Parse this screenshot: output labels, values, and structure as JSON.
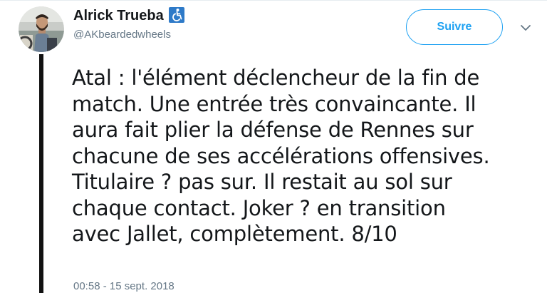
{
  "tweet": {
    "author": {
      "display_name": "Alrick Trueba",
      "badge_icon": "wheelchair-accessibility-icon",
      "handle": "@AKbeardedwheels",
      "avatar_icon": "profile-photo"
    },
    "follow_label": "Suivre",
    "menu_icon": "chevron-down-icon",
    "text": "Atal : l'élément déclencheur de la fin de\nmatch. Une entrée très convaincante. Il\naura fait plier la défense de Rennes sur\nchacune de ses accélérations offensives.\nTitulaire ? pas sur. Il restait au sol sur\nchaque contact. Joker ? en transition\navec Jallet, complètement. 8/10",
    "timestamp": "00:58 - 15 sept. 2018"
  },
  "colors": {
    "link_blue": "#1da1f2",
    "badge_blue": "#2e7ac8",
    "text_primary": "#14171a",
    "text_secondary": "#657786",
    "thread_line": "#111111"
  }
}
